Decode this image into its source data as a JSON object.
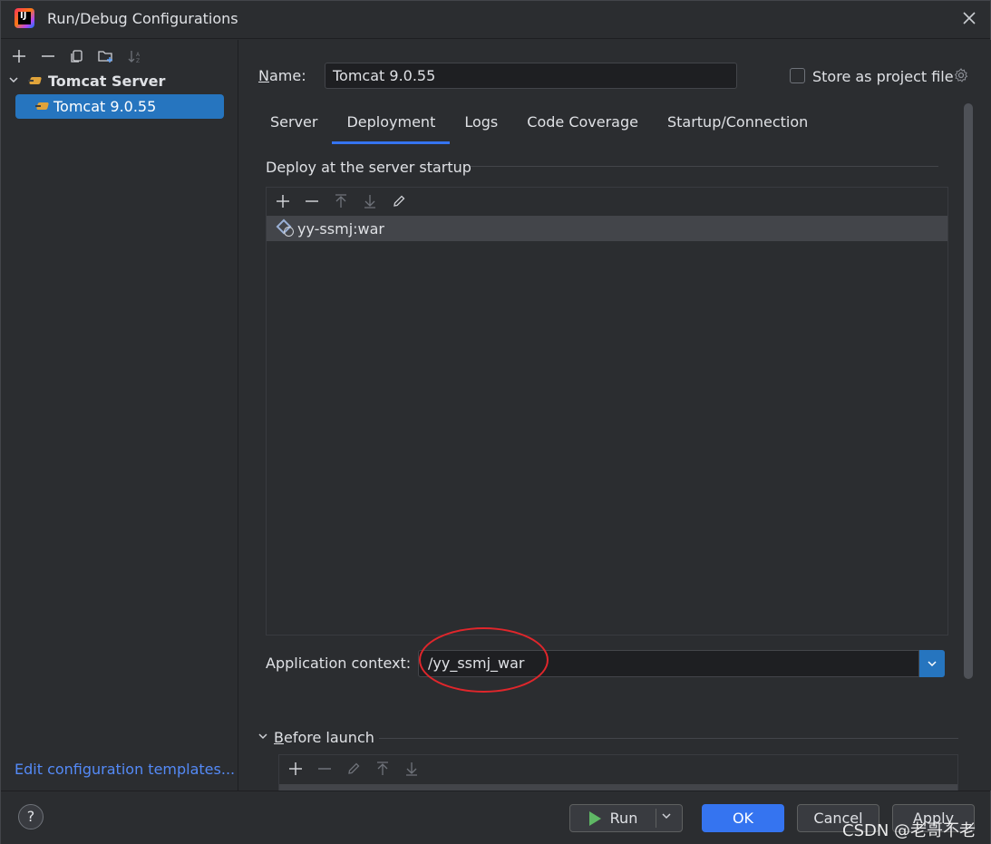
{
  "window": {
    "title": "Run/Debug Configurations",
    "logo_text": "IJ"
  },
  "left_panel": {
    "toolbar": [
      "add-icon",
      "remove-icon",
      "copy-icon",
      "folder-add-icon",
      "sort-icon"
    ],
    "tree": {
      "group_label": "Tomcat Server",
      "item_label": "Tomcat 9.0.55"
    },
    "edit_templates": "Edit configuration templates..."
  },
  "config": {
    "name_label_first": "N",
    "name_label_rest": "ame:",
    "name_value": "Tomcat 9.0.55",
    "store_label": "Store as project file",
    "store_checked": false
  },
  "tabs": [
    {
      "label": "Server",
      "active": false
    },
    {
      "label": "Deployment",
      "active": true
    },
    {
      "label": "Logs",
      "active": false
    },
    {
      "label": "Code Coverage",
      "active": false
    },
    {
      "label": "Startup/Connection",
      "active": false
    }
  ],
  "deployment": {
    "section_title": "Deploy at the server startup",
    "artifacts": [
      "yy-ssmj:war"
    ],
    "context_label": "Application context:",
    "context_value": "/yy_ssmj_war"
  },
  "before_launch": {
    "label_first": "B",
    "label_rest": "efore launch"
  },
  "buttons": {
    "help": "?",
    "run": "Run",
    "ok": "OK",
    "cancel": "Cancel",
    "apply": "Apply"
  },
  "watermark": "CSDN @老哥不老",
  "colors": {
    "accent": "#3574f0",
    "selection": "#2675bf",
    "annotation_circle": "#e0262b",
    "run_green": "#5fb865"
  }
}
